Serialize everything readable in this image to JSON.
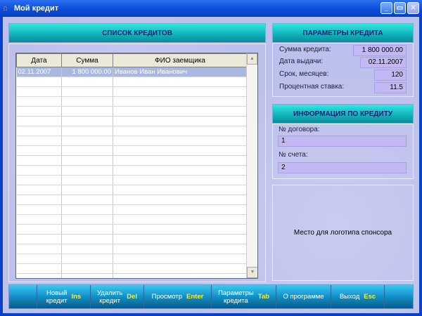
{
  "window": {
    "title": "Мой кредит",
    "min": "_",
    "max": "▭",
    "close": "✕"
  },
  "list": {
    "title": "СПИСОК КРЕДИТОВ",
    "columns": [
      "Дата",
      "Сумма",
      "ФИО заемщика"
    ],
    "rows": [
      {
        "date": "02.11.2007",
        "sum": "1 800 000.00",
        "name": "Иванов Иван Иванович"
      }
    ]
  },
  "params": {
    "title": "ПАРАМЕТРЫ КРЕДИТА",
    "amount_label": "Сумма кредита:",
    "amount": "1 800 000.00",
    "date_label": "Дата выдачи:",
    "date": "02.11.2007",
    "term_label": "Срок, месяцев:",
    "term": "120",
    "rate_label": "Процентная ставка:",
    "rate": "11.5"
  },
  "info": {
    "title": "ИНФОРМАЦИЯ ПО КРЕДИТУ",
    "contract_label": "№ договора:",
    "contract": "1",
    "account_label": "№ счета:",
    "account": "2"
  },
  "sponsor": {
    "text": "Место для логотипа спонсора"
  },
  "toolbar": [
    {
      "label1": "Новый",
      "label2": "кредит",
      "key": "Ins"
    },
    {
      "label1": "Удалить",
      "label2": "кредит",
      "key": "Del"
    },
    {
      "label1": "Просмотр",
      "label2": "",
      "key": "Enter"
    },
    {
      "label1": "Параметры",
      "label2": "кредита",
      "key": "Tab"
    },
    {
      "label1": "О программе",
      "label2": "",
      "key": ""
    },
    {
      "label1": "Выход",
      "label2": "",
      "key": "Esc"
    }
  ]
}
